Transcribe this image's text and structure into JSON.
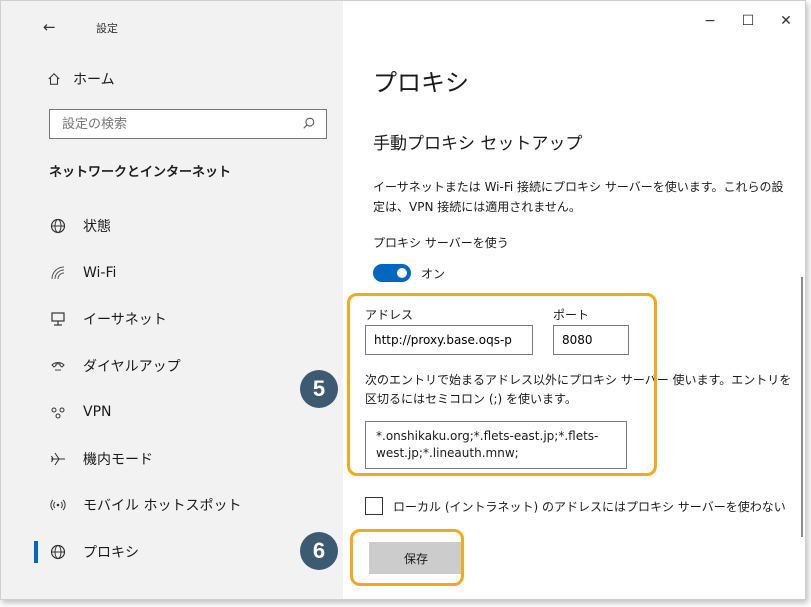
{
  "titlebar": {
    "back_glyph": "←",
    "title": "設定"
  },
  "window_controls": {
    "minimize": "−",
    "maximize": "☐",
    "close": "✕"
  },
  "sidebar": {
    "home_label": "ホーム",
    "search_placeholder": "設定の検索",
    "section_title": "ネットワークとインターネット",
    "items": [
      {
        "label": "状態",
        "icon": "globe-icon"
      },
      {
        "label": "Wi-Fi",
        "icon": "wifi-icon"
      },
      {
        "label": "イーサネット",
        "icon": "ethernet-icon"
      },
      {
        "label": "ダイヤルアップ",
        "icon": "dialup-icon"
      },
      {
        "label": "VPN",
        "icon": "vpn-icon"
      },
      {
        "label": "機内モード",
        "icon": "airplane-icon"
      },
      {
        "label": "モバイル ホットスポット",
        "icon": "hotspot-icon"
      },
      {
        "label": "プロキシ",
        "icon": "globe-icon",
        "active": true
      }
    ]
  },
  "main": {
    "page_title": "プロキシ",
    "subheading": "手動プロキシ セットアップ",
    "description": "イーサネットまたは Wi-Fi 接続にプロキシ サーバーを使います。これらの設定は、VPN 接続には適用されません。",
    "use_proxy_label": "プロキシ サーバーを使う",
    "toggle_state": "オン",
    "address_label": "アドレス",
    "address_value": "http://proxy.base.oqs-p",
    "port_label": "ポート",
    "port_value": "8080",
    "exceptions_description": "次のエントリで始まるアドレス以外にプロキシ サーバー 使います。エントリを区切るにはセミコロン (;) を使います。",
    "exceptions_value": "*.onshikaku.org;*.flets-east.jp;*.flets-west.jp;*.lineauth.mnw;",
    "local_bypass_label": "ローカル (イントラネット) のアドレスにはプロキシ サーバーを使わない",
    "save_label": "保存"
  },
  "annotations": {
    "step5": "5",
    "step6": "6",
    "highlight_color": "#f5a81c",
    "badge_color": "#3d5a73"
  },
  "colors": {
    "accent": "#0067c0",
    "sidebar_bg": "#f2f2f2"
  }
}
